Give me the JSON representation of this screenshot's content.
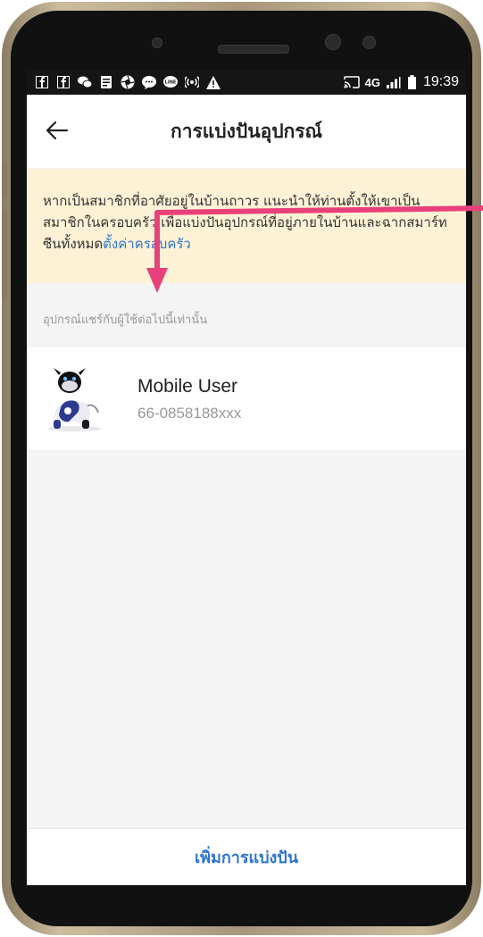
{
  "status_bar": {
    "network": "4G",
    "time": "19:39",
    "icons": [
      "facebook-icon",
      "facebook-icon",
      "wechat-icon",
      "notes-icon",
      "shutter-icon",
      "message-icon",
      "line-icon",
      "hotspot-icon",
      "warning-icon",
      "cast-icon",
      "signal-icon",
      "battery-icon"
    ]
  },
  "header": {
    "title": "การแบ่งปันอุปกรณ์",
    "back_icon": "arrow-left-icon"
  },
  "notice": {
    "text": "หากเป็นสมาชิกที่อาศัยอยู่ในบ้านถาวร แนะนำให้ท่านตั้งให้เขาเป็นสมาชิกในครอบครัว เพื่อแบ่งปันอุปกรณ์ที่อยู่ภายในบ้านและฉากสมาร์ทซีนทั้งหมด",
    "link": "ตั้งค่าครอบครัว"
  },
  "section": {
    "label": "อุปกรณ์แชร์กับผู้ใช้ต่อไปนี้เท่านั้น"
  },
  "users": [
    {
      "name": "Mobile User",
      "phone": "66-0858188xxx"
    }
  ],
  "footer": {
    "add_label": "เพิ่มการแบ่งปัน"
  },
  "colors": {
    "accent": "#2f74d0",
    "notice_bg": "#fdf2d6",
    "annotation": "#e8407a"
  }
}
